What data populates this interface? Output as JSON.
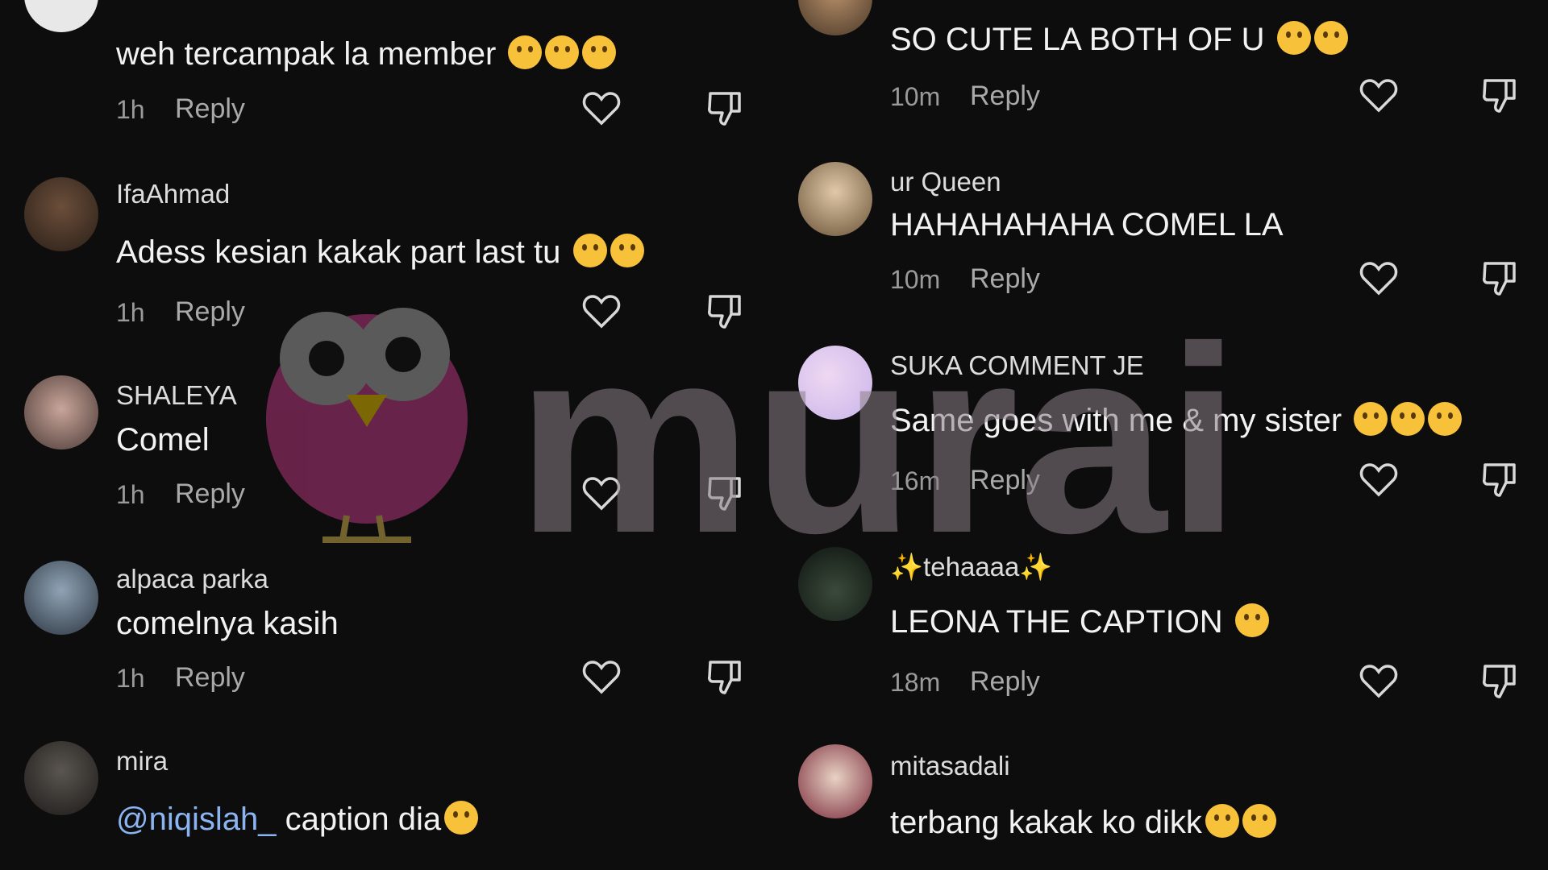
{
  "left_comments": [
    {
      "username": "",
      "text": "weh tercampak la member",
      "time": "1h",
      "reply": "Reply",
      "emojis": [
        "pleading-face-emoji",
        "melting-face-emoji",
        "rofl-emoji"
      ]
    },
    {
      "username": "IfaAhmad",
      "text": "Adess kesian kakak part last tu",
      "time": "1h",
      "reply": "Reply",
      "emojis": [
        "sweat-smile-emoji",
        "joy-emoji"
      ]
    },
    {
      "username": "SHALEYA",
      "text": "Comel",
      "time": "1h",
      "reply": "Reply",
      "emojis": []
    },
    {
      "username": "alpaca parka",
      "text": "comelnya kasih",
      "time": "1h",
      "reply": "Reply",
      "emojis": []
    },
    {
      "username": "mira",
      "mention": "@niqislah_",
      "text": " caption dia",
      "time": "1h",
      "reply": "Reply",
      "emojis": [
        "loudly-crying-emoji"
      ]
    }
  ],
  "right_comments": [
    {
      "username": "",
      "text": "SO CUTE LA BOTH OF U",
      "time": "10m",
      "reply": "Reply",
      "emojis": [
        "tired-face-emoji",
        "heart-hands-emoji"
      ]
    },
    {
      "username": "ur Queen",
      "text": "HAHAHAHAHA COMEL LA",
      "time": "10m",
      "reply": "Reply",
      "emojis": []
    },
    {
      "username": "SUKA COMMENT JE",
      "text": "Same goes with me & my sister",
      "time": "16m",
      "reply": "Reply",
      "emojis": [
        "joy-emoji",
        "sweat-smile-emoji",
        "joy-emoji"
      ]
    },
    {
      "username": "✨tehaaaa✨",
      "text": "LEONA THE CAPTION",
      "time": "18m",
      "reply": "Reply",
      "emojis": [
        "loudly-crying-emoji"
      ]
    },
    {
      "username": "mitasadali",
      "text": "terbang kakak ko dikk",
      "time": "",
      "reply": "",
      "emojis": [
        "rofl-emoji",
        "rofl-emoji"
      ]
    }
  ],
  "watermark": {
    "text": "murai",
    "color": "#8a7f86",
    "bird_color": "#c24a8a"
  },
  "colors": {
    "background": "#0d0d0d",
    "mention": "#8ab4f2"
  }
}
